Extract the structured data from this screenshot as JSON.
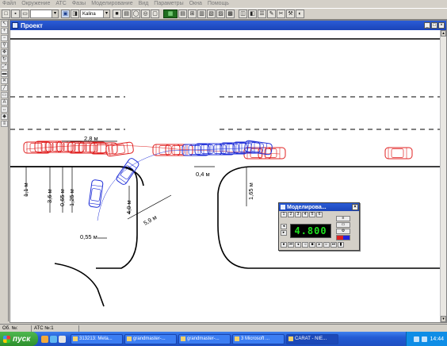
{
  "menu": [
    "Файл",
    "Окружение",
    "АТС",
    "Фазы",
    "Моделирование",
    "Вид",
    "Параметры",
    "Окна",
    "Помощь"
  ],
  "toolbar": {
    "font_select": "Kalina",
    "icons": [
      "new-icon",
      "save-icon",
      "print-icon",
      "select-icon",
      "move-icon",
      "ruler-icon",
      "grid-icon",
      "zoom-icon",
      "color-icon"
    ]
  },
  "document": {
    "title": "Проект",
    "measurements": [
      "2,8 м",
      "1,1 м",
      "3,6 м",
      "0,65 м",
      "1,25 м",
      "4,0 м",
      "5,9 м",
      "0,55 м",
      "0,4 м",
      "1,65 м"
    ]
  },
  "simulation_panel": {
    "title": "Моделирова...",
    "lcd_value": "4.800",
    "buttons": [
      "1",
      "2",
      "3",
      "4",
      "5",
      "6"
    ]
  },
  "statusbar": {
    "left": "Об. №:",
    "atc": "АТС №:1"
  },
  "taskbar": {
    "start_label": "пуск",
    "tasks": [
      "313213: Meta...",
      "grandmaster-...",
      "grandmaster-...",
      "3 Microsoft ...",
      "CARAT - NIE..."
    ],
    "clock": "14:44"
  },
  "colors": {
    "red_vehicle": "#e02020",
    "blue_vehicle": "#1f2fd8",
    "titlebar": "#1f4fc8",
    "lcd_text": "#1fe21f"
  }
}
